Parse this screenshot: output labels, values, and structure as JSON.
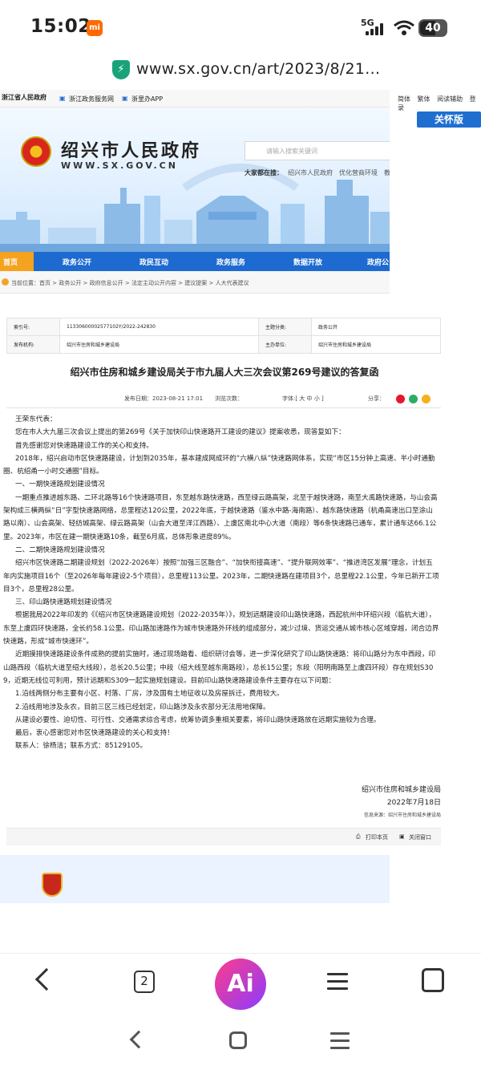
{
  "status_bar": {
    "time": "15:02",
    "app_badge": "mi",
    "signal": "5G",
    "battery": "40"
  },
  "url_bar": {
    "url": "www.sx.gov.cn/art/2023/8/21..."
  },
  "top_strip": {
    "logo_text": "浙江省人民政府",
    "link_1": "浙江政务服务网",
    "link_2": "浙里办APP"
  },
  "top_links": [
    "简体",
    "繁体",
    "阅读辅助",
    "登录"
  ],
  "care_button": "关怀版",
  "banner": {
    "site_name": "绍兴市人民政府",
    "site_domain": "WWW.SX.GOV.CN",
    "search_placeholder": "请输入搜索关键词",
    "hot_label": "大家都在搜：",
    "hot_items": [
      "绍兴市人民政府",
      "优化营商环境",
      "教育"
    ]
  },
  "nav": [
    "首页",
    "政务公开",
    "政民互动",
    "政务服务",
    "数据开放",
    "政府公"
  ],
  "breadcrumb": "当前位置：首页 > 政务公开 > 政府信息公开 > 法定主动公开内容 > 建议提案 > 人大代表建议",
  "info": {
    "index_label": "索引号:",
    "index_value": "11330600002577102Y/2022-242830",
    "topic_label": "主题分类:",
    "topic_value": "政务公开",
    "issuer_label": "发布机构:",
    "issuer_value": "绍兴市住房和城乡建设局",
    "host_label": "主办单位:",
    "host_value": "绍兴市住房和城乡建设局"
  },
  "article": {
    "title": "绍兴市住房和城乡建设局关于市九届人大三次会议第269号建议的答复函",
    "date": "发布日期：2023-08-21 17:01",
    "views": "浏览次数：",
    "font_size": "字体:[ 大 中 小 ]",
    "share": "分享：",
    "paragraphs": [
      "王荣东代表：",
      "您在市人大九届三次会议上提出的第269号《关于加快印山快速路开工建设的建议》提案收悉，现答复如下：",
      "首先感谢您对快速路建设工作的关心和支持。",
      "2018年，绍兴启动市区快速路建设，计划到2035年，基本建成网成环的“六横八纵”快速路网体系，实现“市区15分钟上高速、半小时通勤圈、杭绍甬一小时交通圈”目标。",
      "一、一期快速路规划建设情况",
      "一期重点推进越东路、二环北路等16个快速路项目，东至越东路快速路，西至绿云路高架，北至于越快速路，南至大禹路快速路，与山会高架构成三横两纵“日”字型快速路网络，总里程达120公里，2022年底，于越快速路（鉴水中路-海南路）、越东路快速路（杭甬高速出口至涂山路以南）、山会高架、轻纺城高架、绿云路高架（山会大道至洋江西路）、上虞区南北中心大道（南段）等6条快速路已通车，累计通车达66.1公里。2023年，市区在建一期快速路10条，截至6月底，总体形象进度89%。",
      "二、二期快速路规划建设情况",
      "绍兴市区快速路二期建设规划（2022-2026年）按照“加强三区融合”、“加快衔接高速”、“提升联网效率”、“推进湾区发展”理念，计划五年内实施项目16个（至2026年每年建设2-5个项目），总里程113公里。2023年，二期快速路在建项目3个，总里程22.1公里，今年已新开工项目3个，总里程28公里。",
      "三、印山路快速路规划建设情况",
      "根据我局2022年印发的《《绍兴市区快速路建设规划（2022-2035年）》，规划远期建设印山路快速路，西起杭州中环绍兴段（临杭大道），东至上虞四环快速路，全长约58.1公里。印山路加速路作为城市快速路外环线的组成部分，减少过境、货运交通从城市核心区域穿越，闭合边界快速路，形成“城市快速环”。",
      "近期摸排快速路建设条件成熟的提前实施时，通过现场踏看、组织研讨会等，进一步深化研究了印山路快速路：将印山路分为东中西段，印山路西段（临杭大道至绍大线段），总长20.5公里；中段（绍大线至越东南路段），总长15公里；东段（阳明南路至上虞四环段）存在规划S309，近期无线位可利用，预计远期和S309一起实施规划建设。目前印山路快速路建设条件主要存在以下问题：",
      "1.沿线两侧分布主要有小区、村落、厂房，涉及国有土地征收以及房屋拆迁，费用较大。",
      "2.沿线用地涉及永农，目前三区三线已经划定，印山路涉及永农部分无法用地保障。",
      "从建设必要性、迫切性、可行性、交通需求综合考虑，统筹协调多重相关要素，将印山路快速路放在远期实施较为合理。",
      "最后，衷心感谢您对市区快速路建设的关心和支持！",
      "联系人：徐杨洁；联系方式：85129105。"
    ],
    "signature_org": "绍兴市住房和城乡建设局",
    "signature_date": "2022年7月18日",
    "source": "信息来源：绍兴市住房和城乡建设局",
    "print": "打印本页",
    "close": "关闭窗口"
  },
  "toolbar": {
    "tabs_count": "2",
    "ai_label": "Ai"
  },
  "colors": {
    "nav_blue": "#1d6ad0",
    "accent_orange": "#f0a52a",
    "ai_gradient_start": "#ff3c8a",
    "ai_gradient_end": "#8a3cff"
  }
}
